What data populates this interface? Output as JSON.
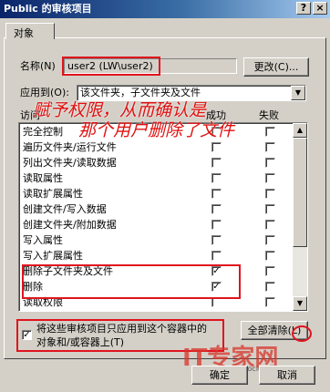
{
  "window": {
    "title": "Public 的审核项目",
    "help_button": "?",
    "close_button": "×"
  },
  "tab": {
    "label": "对象"
  },
  "name_row": {
    "label": "名称",
    "accel": "(N)",
    "value": "user2 (LW\\user2)",
    "change_button": "更改(C)..."
  },
  "apply_row": {
    "label": "应用到",
    "accel": "(O):",
    "value": "该文件夹，子文件夹及文件"
  },
  "list": {
    "header_access": "访问",
    "header_success": "成功",
    "header_fail": "失败",
    "rows": [
      {
        "label": "完全控制",
        "success": false,
        "fail": false
      },
      {
        "label": "遍历文件夹/运行文件",
        "success": false,
        "fail": false
      },
      {
        "label": "列出文件夹/读取数据",
        "success": false,
        "fail": false
      },
      {
        "label": "读取属性",
        "success": false,
        "fail": false
      },
      {
        "label": "读取扩展属性",
        "success": false,
        "fail": false
      },
      {
        "label": "创建文件/写入数据",
        "success": false,
        "fail": false
      },
      {
        "label": "创建文件夹/附加数据",
        "success": false,
        "fail": false
      },
      {
        "label": "写入属性",
        "success": false,
        "fail": false
      },
      {
        "label": "写入扩展属性",
        "success": false,
        "fail": false
      },
      {
        "label": "删除子文件夹及文件",
        "success": true,
        "fail": false
      },
      {
        "label": "删除",
        "success": true,
        "fail": false
      },
      {
        "label": "读取权限",
        "success": false,
        "fail": false
      }
    ]
  },
  "annotation": {
    "line1": "赋予权限，从而确认是",
    "line2": "那个用户删除了文件"
  },
  "apply_checkbox": {
    "checked": true,
    "line1": "将这些审核项目只应用到这个容器中的",
    "line2": "对象和/或容器上(T)"
  },
  "buttons": {
    "clear_all": "全部清除(L)",
    "ok": "确定",
    "cancel": "取消"
  },
  "watermark": {
    "brand": "IT专家网",
    "url": "ctocio.com.cn"
  },
  "colors": {
    "titlebar": "#0a246a",
    "annotation_red": "#e0141e",
    "dialog_bg": "#d4d0c8"
  }
}
